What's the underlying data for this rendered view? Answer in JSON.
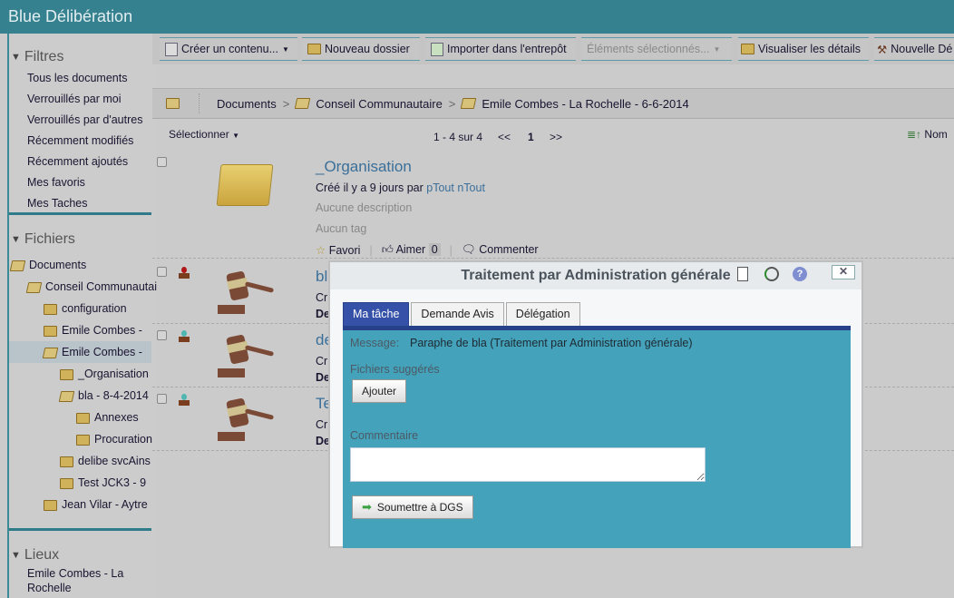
{
  "app": {
    "title": "Blue Délibération"
  },
  "sidebar": {
    "filters": {
      "title": "Filtres",
      "items": [
        "Tous les documents",
        "Verrouillés par moi",
        "Verrouillés par d'autres",
        "Récemment modifiés",
        "Récemment ajoutés",
        "Mes favoris",
        "Mes Taches"
      ]
    },
    "files": {
      "title": "Fichiers",
      "tree": [
        {
          "label": "Documents",
          "level": 0,
          "open": true
        },
        {
          "label": "Conseil Communautaire",
          "level": 1,
          "open": true
        },
        {
          "label": "configuration",
          "level": 2
        },
        {
          "label": "Emile Combes -",
          "level": 2
        },
        {
          "label": "Emile Combes -",
          "level": 2,
          "open": true,
          "selected": true
        },
        {
          "label": "_Organisation",
          "level": 3
        },
        {
          "label": "bla - 8-4-2014",
          "level": 3,
          "open": true
        },
        {
          "label": "Annexes",
          "level": 4
        },
        {
          "label": "Procuration",
          "level": 4
        },
        {
          "label": "delibe svcAins",
          "level": 3
        },
        {
          "label": "Test JCK3 - 9",
          "level": 3
        },
        {
          "label": "Jean Vilar - Aytre",
          "level": 2
        }
      ]
    },
    "places": {
      "title": "Lieux",
      "items": [
        "Emile Combes - La",
        "Rochelle"
      ]
    }
  },
  "toolbar": {
    "buttons": [
      "Créer un contenu...",
      "Nouveau dossier",
      "Importer dans l'entrepôt",
      "Éléments sélectionnés...",
      "Visualiser les détails",
      "Nouvelle Dé"
    ]
  },
  "breadcrumb": [
    "Documents",
    "Conseil Communautaire",
    "Emile Combes - La Rochelle - 6-6-2014"
  ],
  "listbar": {
    "select": "Sélectionner",
    "range": "1 - 4 sur 4",
    "prev": "<<",
    "page": "1",
    "next": ">>",
    "sort": "Nom"
  },
  "rows": [
    {
      "title": "_Organisation",
      "created": "Créé il y a 9 jours par ",
      "author": "pTout nTout",
      "description": "Aucune description",
      "tags": "Aucun tag",
      "favori": "Favori",
      "aimer": "Aimer",
      "likes": "0",
      "comment": "Commenter"
    },
    {
      "title": "bl",
      "l1": "Cr",
      "l2": "De",
      "stamp": "red"
    },
    {
      "title": "de",
      "l1": "Cr",
      "l2": "De",
      "stamp": "teal"
    },
    {
      "title": "Te",
      "l1": "Cr",
      "l2": "De",
      "stamp": "teal"
    }
  ],
  "dialog": {
    "title": "Traitement par Administration générale",
    "close": "✕",
    "tabs": [
      "Ma tâche",
      "Demande Avis",
      "Délégation"
    ],
    "message_label": "Message:",
    "message": "Paraphe de bla (Traitement par Administration générale)",
    "files_label": "Fichiers suggérés",
    "add": "Ajouter",
    "comment_label": "Commentaire",
    "comment_value": "",
    "submit": "Soumettre à DGS"
  }
}
